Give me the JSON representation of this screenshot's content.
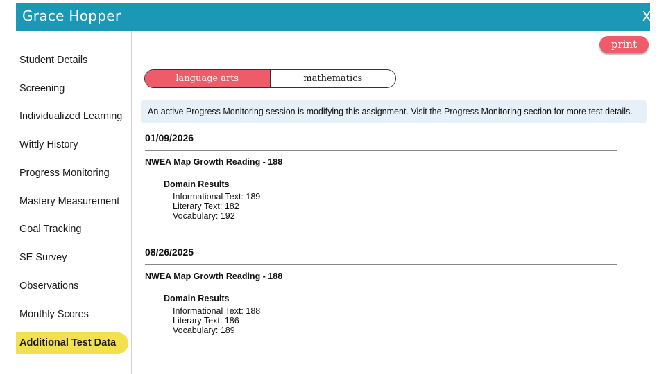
{
  "header": {
    "title": "Grace Hopper",
    "close_label": "X"
  },
  "sidebar": {
    "items": [
      {
        "label": "Student Details"
      },
      {
        "label": "Screening"
      },
      {
        "label": "Individualized Learning"
      },
      {
        "label": "Wittly History"
      },
      {
        "label": "Progress Monitoring"
      },
      {
        "label": "Mastery Measurement"
      },
      {
        "label": "Goal Tracking"
      },
      {
        "label": "SE Survey"
      },
      {
        "label": "Observations"
      },
      {
        "label": "Monthly Scores"
      },
      {
        "label": "Additional Test Data",
        "active": true
      }
    ]
  },
  "toolbar": {
    "print_label": "print"
  },
  "subjects": {
    "selected": "language arts",
    "other": "mathematics"
  },
  "notice": {
    "text": "An active Progress Monitoring session is modifying this assignment. Visit the Progress Monitoring section for more test details."
  },
  "records": [
    {
      "date": "01/09/2026",
      "test": "NWEA Map Growth Reading - 188",
      "domain_title": "Domain Results",
      "domains": [
        "Informational Text: 189",
        "Literary Text: 182",
        "Vocabulary: 192"
      ]
    },
    {
      "date": "08/26/2025",
      "test": "NWEA Map Growth Reading - 188",
      "domain_title": "Domain Results",
      "domains": [
        "Informational Text: 188",
        "Literary Text: 186",
        "Vocabulary: 189"
      ]
    }
  ],
  "colors": {
    "header": "#1a98b5",
    "accent_pink": "#ef5b69",
    "active_yellow": "#f2e04e",
    "notice_bg": "#e6f0f9"
  }
}
